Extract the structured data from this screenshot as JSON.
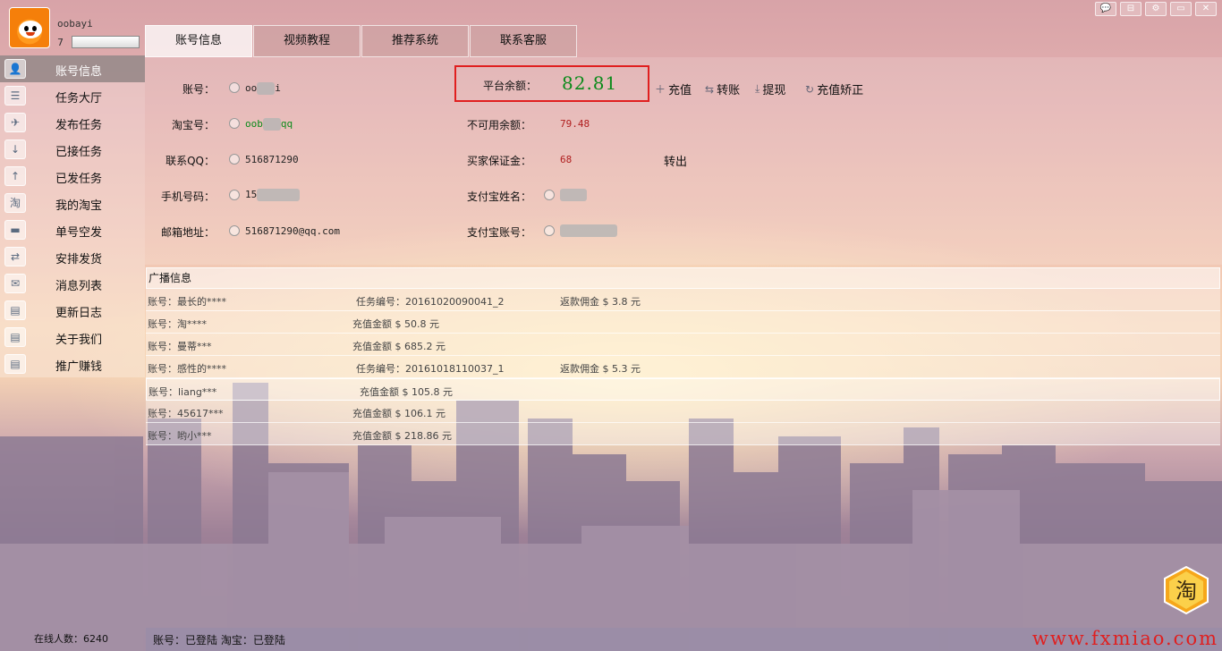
{
  "user": {
    "name": "oobayi",
    "level": "7"
  },
  "window_controls": [
    "💬",
    "⊟",
    "⚙",
    "▭",
    "✕"
  ],
  "sidebar": {
    "items": [
      {
        "label": "账号信息",
        "icon": "user-icon"
      },
      {
        "label": "任务大厅",
        "icon": "list-icon"
      },
      {
        "label": "发布任务",
        "icon": "plane-icon"
      },
      {
        "label": "已接任务",
        "icon": "download-icon"
      },
      {
        "label": "已发任务",
        "icon": "upload-icon"
      },
      {
        "label": "我的淘宝",
        "icon": "taobao-icon"
      },
      {
        "label": "单号空发",
        "icon": "truck-icon"
      },
      {
        "label": "安排发货",
        "icon": "ship-icon"
      },
      {
        "label": "消息列表",
        "icon": "message-icon"
      },
      {
        "label": "更新日志",
        "icon": "card-icon"
      },
      {
        "label": "关于我们",
        "icon": "card-icon"
      },
      {
        "label": "推广赚钱",
        "icon": "card-icon"
      }
    ],
    "online_count": "在线人数：6240"
  },
  "tabs": [
    "账号信息",
    "视频教程",
    "推荐系统",
    "联系客服"
  ],
  "account": {
    "account_label": "账号：",
    "account_value_prefix": "oo",
    "account_value_suffix": "i",
    "taobao_label": "淘宝号：",
    "taobao_value_prefix": "oob",
    "taobao_value_suffix": "qq",
    "qq_label": "联系QQ：",
    "qq_value": "516871290",
    "phone_label": "手机号码：",
    "phone_value_prefix": "15",
    "email_label": "邮箱地址：",
    "email_value": "516871290@qq.com",
    "balance_label": "平台余额：",
    "balance_value": "82.81",
    "unavailable_label": "不可用余额：",
    "unavailable_value": "79.48",
    "deposit_label": "买家保证金：",
    "deposit_value": "68",
    "alipay_name_label": "支付宝姓名：",
    "alipay_account_label": "支付宝账号：",
    "transfer_out": "转出"
  },
  "actions": {
    "recharge": "充值",
    "transfer": "转账",
    "withdraw": "提现",
    "correct": "充值矫正"
  },
  "broadcast": {
    "title": "广播信息",
    "rows": [
      {
        "user": "账号：最长的****",
        "mid": "任务编号：20161020090041_2",
        "right": "返款佣金 $ 3.8 元",
        "type": "task"
      },
      {
        "user": "账号：淘****",
        "mid": "充值金额 $ 50.8 元",
        "right": "",
        "type": "charge"
      },
      {
        "user": "账号：曼蒂***",
        "mid": "充值金额 $ 685.2 元",
        "right": "",
        "type": "charge"
      },
      {
        "user": "账号：感性的****",
        "mid": "任务编号：20161018110037_1",
        "right": "返款佣金 $ 5.3 元",
        "type": "task"
      },
      {
        "user": "账号：liang***",
        "mid": "充值金额 $ 105.8 元",
        "right": "",
        "type": "charge2"
      },
      {
        "user": "账号：45617***",
        "mid": "充值金额 $ 106.1 元",
        "right": "",
        "type": "charge"
      },
      {
        "user": "账号：哟小***",
        "mid": "充值金额 $ 218.86 元",
        "right": "",
        "type": "charge"
      }
    ]
  },
  "status": {
    "text": "账号：已登陆 淘宝：已登陆"
  },
  "watermark": "www.fxmiao.com",
  "badge": "淘",
  "colors": {
    "accent_green": "#0a8a1a",
    "accent_red": "#b01e1e",
    "highlight_box": "#e01f1f"
  }
}
